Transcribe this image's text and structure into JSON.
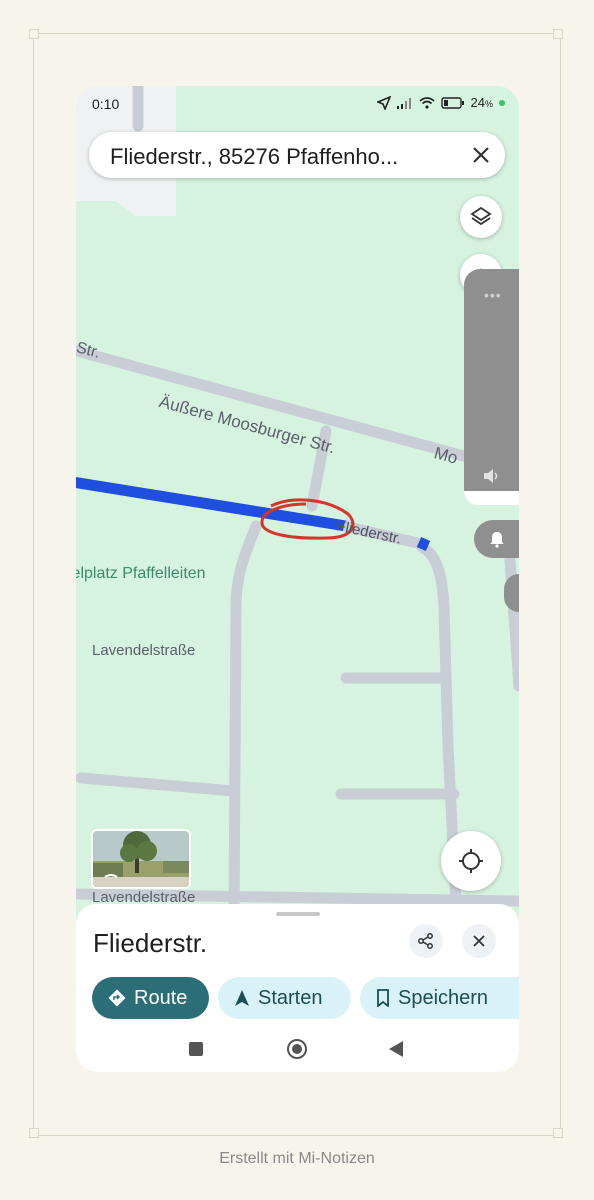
{
  "status": {
    "time": "0:10",
    "battery": "24"
  },
  "search": {
    "query": "Fliederstr., 85276 Pfaffenho..."
  },
  "map": {
    "labels": {
      "street_upper_left": "Str.",
      "street_main": "Äußere Moosburger Str.",
      "street_main_right": "Mo",
      "street_route": "Fliederstr.",
      "poi": "ielplatz Pfaffelleiten",
      "street_lavendel_1": "Lavendelstraße",
      "street_lavendel_2": "Lavendelstraße"
    },
    "colors": {
      "route": "#1f4ee0",
      "annotation": "#d9342b",
      "green": "#d6f3df",
      "road": "#c8cdd6"
    }
  },
  "sheet": {
    "place_title": "Fliederstr.",
    "route_label": "Route",
    "start_label": "Starten",
    "save_label": "Speichern"
  },
  "footer": {
    "text": "Erstellt mit Mi-Notizen"
  }
}
